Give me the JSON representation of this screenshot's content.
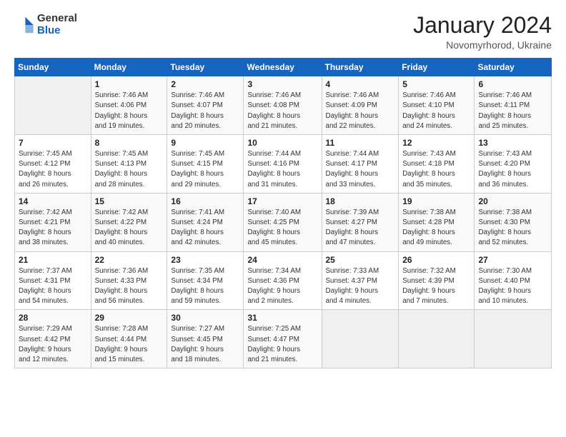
{
  "logo": {
    "general": "General",
    "blue": "Blue"
  },
  "header": {
    "title": "January 2024",
    "subtitle": "Novomyrhorod, Ukraine"
  },
  "calendar": {
    "days_of_week": [
      "Sunday",
      "Monday",
      "Tuesday",
      "Wednesday",
      "Thursday",
      "Friday",
      "Saturday"
    ],
    "weeks": [
      [
        {
          "day": "",
          "info": ""
        },
        {
          "day": "1",
          "info": "Sunrise: 7:46 AM\nSunset: 4:06 PM\nDaylight: 8 hours\nand 19 minutes."
        },
        {
          "day": "2",
          "info": "Sunrise: 7:46 AM\nSunset: 4:07 PM\nDaylight: 8 hours\nand 20 minutes."
        },
        {
          "day": "3",
          "info": "Sunrise: 7:46 AM\nSunset: 4:08 PM\nDaylight: 8 hours\nand 21 minutes."
        },
        {
          "day": "4",
          "info": "Sunrise: 7:46 AM\nSunset: 4:09 PM\nDaylight: 8 hours\nand 22 minutes."
        },
        {
          "day": "5",
          "info": "Sunrise: 7:46 AM\nSunset: 4:10 PM\nDaylight: 8 hours\nand 24 minutes."
        },
        {
          "day": "6",
          "info": "Sunrise: 7:46 AM\nSunset: 4:11 PM\nDaylight: 8 hours\nand 25 minutes."
        }
      ],
      [
        {
          "day": "7",
          "info": "Sunrise: 7:45 AM\nSunset: 4:12 PM\nDaylight: 8 hours\nand 26 minutes."
        },
        {
          "day": "8",
          "info": "Sunrise: 7:45 AM\nSunset: 4:13 PM\nDaylight: 8 hours\nand 28 minutes."
        },
        {
          "day": "9",
          "info": "Sunrise: 7:45 AM\nSunset: 4:15 PM\nDaylight: 8 hours\nand 29 minutes."
        },
        {
          "day": "10",
          "info": "Sunrise: 7:44 AM\nSunset: 4:16 PM\nDaylight: 8 hours\nand 31 minutes."
        },
        {
          "day": "11",
          "info": "Sunrise: 7:44 AM\nSunset: 4:17 PM\nDaylight: 8 hours\nand 33 minutes."
        },
        {
          "day": "12",
          "info": "Sunrise: 7:43 AM\nSunset: 4:18 PM\nDaylight: 8 hours\nand 35 minutes."
        },
        {
          "day": "13",
          "info": "Sunrise: 7:43 AM\nSunset: 4:20 PM\nDaylight: 8 hours\nand 36 minutes."
        }
      ],
      [
        {
          "day": "14",
          "info": "Sunrise: 7:42 AM\nSunset: 4:21 PM\nDaylight: 8 hours\nand 38 minutes."
        },
        {
          "day": "15",
          "info": "Sunrise: 7:42 AM\nSunset: 4:22 PM\nDaylight: 8 hours\nand 40 minutes."
        },
        {
          "day": "16",
          "info": "Sunrise: 7:41 AM\nSunset: 4:24 PM\nDaylight: 8 hours\nand 42 minutes."
        },
        {
          "day": "17",
          "info": "Sunrise: 7:40 AM\nSunset: 4:25 PM\nDaylight: 8 hours\nand 45 minutes."
        },
        {
          "day": "18",
          "info": "Sunrise: 7:39 AM\nSunset: 4:27 PM\nDaylight: 8 hours\nand 47 minutes."
        },
        {
          "day": "19",
          "info": "Sunrise: 7:38 AM\nSunset: 4:28 PM\nDaylight: 8 hours\nand 49 minutes."
        },
        {
          "day": "20",
          "info": "Sunrise: 7:38 AM\nSunset: 4:30 PM\nDaylight: 8 hours\nand 52 minutes."
        }
      ],
      [
        {
          "day": "21",
          "info": "Sunrise: 7:37 AM\nSunset: 4:31 PM\nDaylight: 8 hours\nand 54 minutes."
        },
        {
          "day": "22",
          "info": "Sunrise: 7:36 AM\nSunset: 4:33 PM\nDaylight: 8 hours\nand 56 minutes."
        },
        {
          "day": "23",
          "info": "Sunrise: 7:35 AM\nSunset: 4:34 PM\nDaylight: 8 hours\nand 59 minutes."
        },
        {
          "day": "24",
          "info": "Sunrise: 7:34 AM\nSunset: 4:36 PM\nDaylight: 9 hours\nand 2 minutes."
        },
        {
          "day": "25",
          "info": "Sunrise: 7:33 AM\nSunset: 4:37 PM\nDaylight: 9 hours\nand 4 minutes."
        },
        {
          "day": "26",
          "info": "Sunrise: 7:32 AM\nSunset: 4:39 PM\nDaylight: 9 hours\nand 7 minutes."
        },
        {
          "day": "27",
          "info": "Sunrise: 7:30 AM\nSunset: 4:40 PM\nDaylight: 9 hours\nand 10 minutes."
        }
      ],
      [
        {
          "day": "28",
          "info": "Sunrise: 7:29 AM\nSunset: 4:42 PM\nDaylight: 9 hours\nand 12 minutes."
        },
        {
          "day": "29",
          "info": "Sunrise: 7:28 AM\nSunset: 4:44 PM\nDaylight: 9 hours\nand 15 minutes."
        },
        {
          "day": "30",
          "info": "Sunrise: 7:27 AM\nSunset: 4:45 PM\nDaylight: 9 hours\nand 18 minutes."
        },
        {
          "day": "31",
          "info": "Sunrise: 7:25 AM\nSunset: 4:47 PM\nDaylight: 9 hours\nand 21 minutes."
        },
        {
          "day": "",
          "info": ""
        },
        {
          "day": "",
          "info": ""
        },
        {
          "day": "",
          "info": ""
        }
      ]
    ]
  }
}
